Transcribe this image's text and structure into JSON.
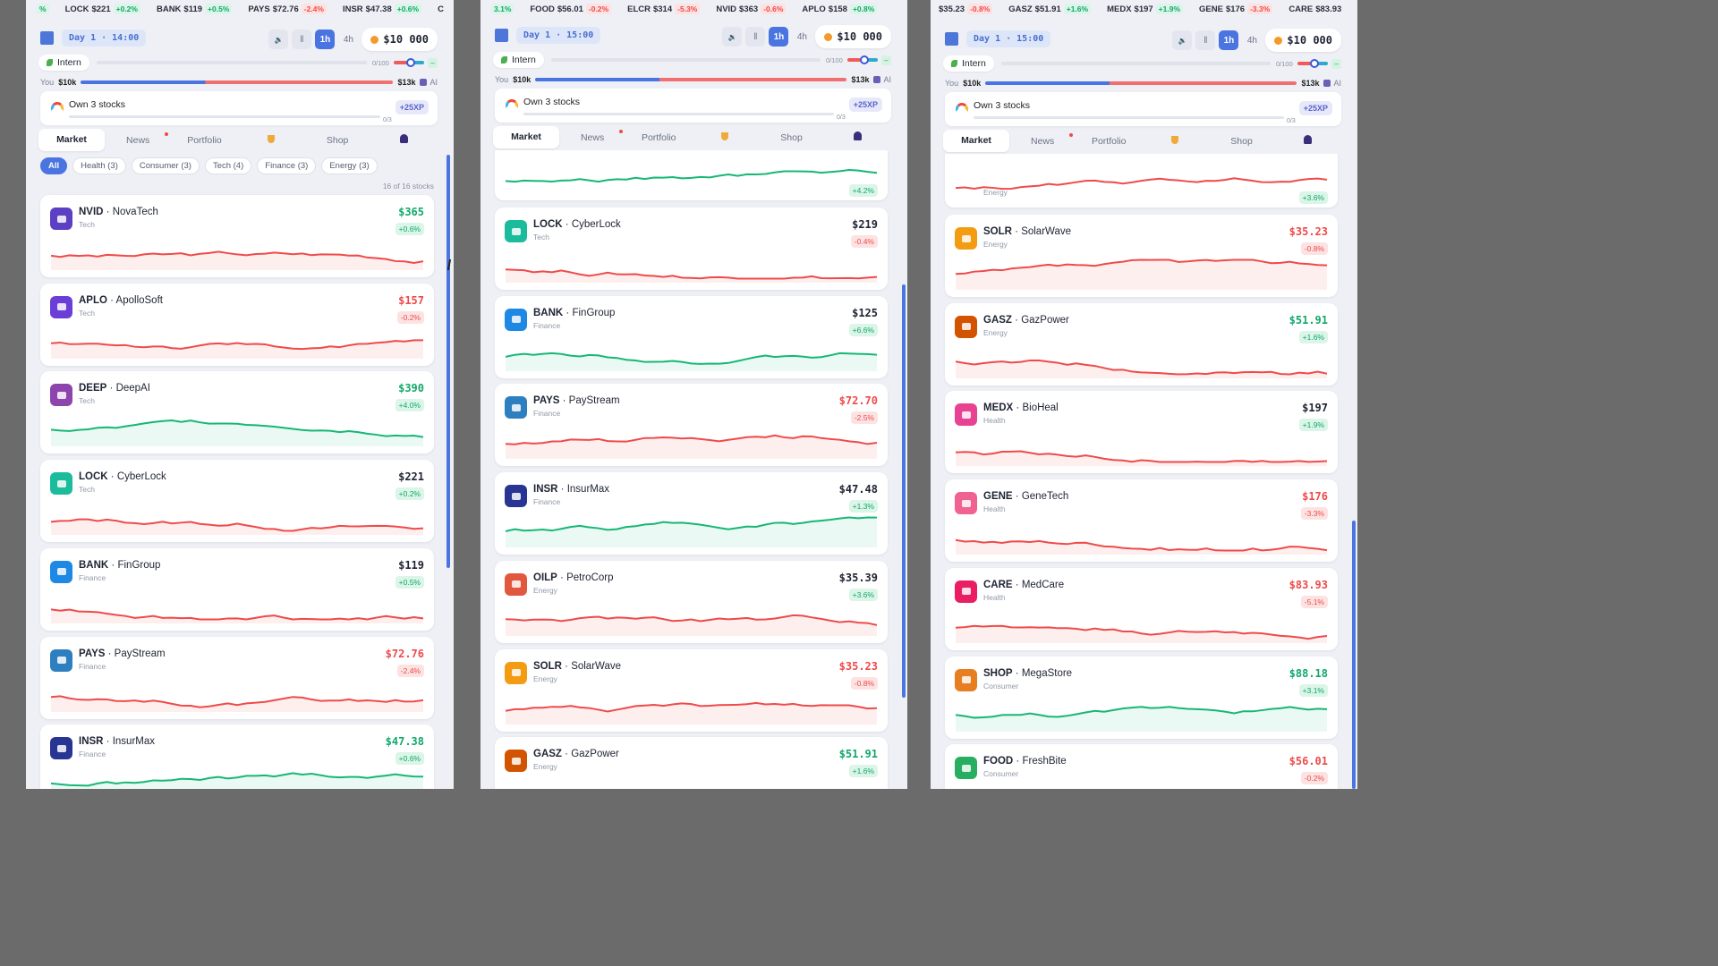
{
  "panels": [
    {
      "ticker": [
        {
          "sym": "",
          "price": "",
          "chg": "%",
          "dir": "up"
        },
        {
          "sym": "LOCK",
          "price": "$221",
          "chg": "+0.2%",
          "dir": "up"
        },
        {
          "sym": "BANK",
          "price": "$119",
          "chg": "+0.5%",
          "dir": "up"
        },
        {
          "sym": "PAYS",
          "price": "$72.76",
          "chg": "-2.4%",
          "dir": "dn"
        },
        {
          "sym": "INSR",
          "price": "$47.38",
          "chg": "+0.6%",
          "dir": "up"
        },
        {
          "sym": "C",
          "price": "",
          "chg": "",
          "dir": "up"
        }
      ],
      "day": "Day 1 · 14:00",
      "cash": "$10 000",
      "rank": "Intern",
      "xp": "0/100",
      "vs": {
        "you": "You",
        "you_val": "$10k",
        "ai_val": "$13k",
        "ai": "AI"
      },
      "goal": {
        "title": "Own 3 stocks",
        "progress": "0/3",
        "reward": "+25XP"
      },
      "tabs": [
        "Market",
        "News",
        "Portfolio",
        "",
        "Shop",
        ""
      ],
      "chips": [
        "All",
        "Health (3)",
        "Consumer (3)",
        "Tech (4)",
        "Finance (3)",
        "Energy (3)"
      ],
      "count": "16 of 16 stocks",
      "stocks": [
        {
          "sym": "NVID",
          "name": "NovaTech",
          "sector": "Tech",
          "price": "$365",
          "chg": "+0.6%",
          "dir": "up",
          "color": "#5b3fc4",
          "trend": "dn"
        },
        {
          "sym": "APLO",
          "name": "ApolloSoft",
          "sector": "Tech",
          "price": "$157",
          "chg": "-0.2%",
          "dir": "dn",
          "color": "#6a3fd8",
          "trend": "dn"
        },
        {
          "sym": "DEEP",
          "name": "DeepAI",
          "sector": "Tech",
          "price": "$390",
          "chg": "+4.0%",
          "dir": "up",
          "color": "#8e44ad",
          "trend": "up"
        },
        {
          "sym": "LOCK",
          "name": "CyberLock",
          "sector": "Tech",
          "price": "$221",
          "chg": "+0.2%",
          "dir": "up",
          "color": "#1abc9c",
          "trend": "dn"
        },
        {
          "sym": "BANK",
          "name": "FinGroup",
          "sector": "Finance",
          "price": "$119",
          "chg": "+0.5%",
          "dir": "up",
          "color": "#1e88e5",
          "trend": "dn"
        },
        {
          "sym": "PAYS",
          "name": "PayStream",
          "sector": "Finance",
          "price": "$72.76",
          "chg": "-2.4%",
          "dir": "dn",
          "color": "#2d7fbf",
          "trend": "dn"
        },
        {
          "sym": "INSR",
          "name": "InsurMax",
          "sector": "Finance",
          "price": "$47.38",
          "chg": "+0.6%",
          "dir": "up",
          "color": "#283593",
          "trend": "up"
        }
      ]
    },
    {
      "ticker": [
        {
          "sym": "",
          "price": "",
          "chg": "3.1%",
          "dir": "up"
        },
        {
          "sym": "FOOD",
          "price": "$56.01",
          "chg": "-0.2%",
          "dir": "dn"
        },
        {
          "sym": "ELCR",
          "price": "$314",
          "chg": "-5.3%",
          "dir": "dn"
        },
        {
          "sym": "NVID",
          "price": "$363",
          "chg": "-0.6%",
          "dir": "dn"
        },
        {
          "sym": "APLO",
          "price": "$158",
          "chg": "+0.8%",
          "dir": "up"
        }
      ],
      "day": "Day 1 · 15:00",
      "cash": "$10 000",
      "rank": "Intern",
      "xp": "0/100",
      "vs": {
        "you": "You",
        "you_val": "$10k",
        "ai_val": "$13k",
        "ai": "AI"
      },
      "goal": {
        "title": "Own 3 stocks",
        "progress": "0/3",
        "reward": "+25XP"
      },
      "tabs": [
        "Market",
        "News",
        "Portfolio",
        "",
        "Shop",
        ""
      ],
      "top_pct": "+4.2%",
      "stocks": [
        {
          "sym": "LOCK",
          "name": "CyberLock",
          "sector": "Tech",
          "price": "$219",
          "chg": "-0.4%",
          "dir": "dn",
          "color": "#1abc9c",
          "trend": "dn"
        },
        {
          "sym": "BANK",
          "name": "FinGroup",
          "sector": "Finance",
          "price": "$125",
          "chg": "+6.6%",
          "dir": "up",
          "color": "#1e88e5",
          "trend": "up"
        },
        {
          "sym": "PAYS",
          "name": "PayStream",
          "sector": "Finance",
          "price": "$72.70",
          "chg": "-2.5%",
          "dir": "dn",
          "color": "#2d7fbf",
          "trend": "dn"
        },
        {
          "sym": "INSR",
          "name": "InsurMax",
          "sector": "Finance",
          "price": "$47.48",
          "chg": "+1.3%",
          "dir": "up",
          "color": "#283593",
          "trend": "up"
        },
        {
          "sym": "OILP",
          "name": "PetroCorp",
          "sector": "Energy",
          "price": "$35.39",
          "chg": "+3.6%",
          "dir": "up",
          "color": "#e2583e",
          "trend": "dn"
        },
        {
          "sym": "SOLR",
          "name": "SolarWave",
          "sector": "Energy",
          "price": "$35.23",
          "chg": "-0.8%",
          "dir": "dn",
          "color": "#f39c12",
          "trend": "dn"
        },
        {
          "sym": "GASZ",
          "name": "GazPower",
          "sector": "Energy",
          "price": "$51.91",
          "chg": "+1.6%",
          "dir": "up",
          "color": "#d35400",
          "trend": "dn"
        }
      ]
    },
    {
      "ticker": [
        {
          "sym": "",
          "price": "$35.23",
          "chg": "-0.8%",
          "dir": "dn"
        },
        {
          "sym": "GASZ",
          "price": "$51.91",
          "chg": "+1.6%",
          "dir": "up"
        },
        {
          "sym": "MEDX",
          "price": "$197",
          "chg": "+1.9%",
          "dir": "up"
        },
        {
          "sym": "GENE",
          "price": "$176",
          "chg": "-3.3%",
          "dir": "dn"
        },
        {
          "sym": "CARE",
          "price": "$83.93",
          "chg": "",
          "dir": "dn"
        }
      ],
      "day": "Day 1 · 15:00",
      "cash": "$10 000",
      "rank": "Intern",
      "xp": "0/100",
      "vs": {
        "you": "You",
        "you_val": "$10k",
        "ai_val": "$13k",
        "ai": "AI"
      },
      "goal": {
        "title": "Own 3 stocks",
        "progress": "0/3",
        "reward": "+25XP"
      },
      "tabs": [
        "Market",
        "News",
        "Portfolio",
        "",
        "Shop",
        ""
      ],
      "top_sector": "Energy",
      "top_pct": "+3.6%",
      "stocks": [
        {
          "sym": "SOLR",
          "name": "SolarWave",
          "sector": "Energy",
          "price": "$35.23",
          "chg": "-0.8%",
          "dir": "dn",
          "color": "#f39c12",
          "trend": "dn"
        },
        {
          "sym": "GASZ",
          "name": "GazPower",
          "sector": "Energy",
          "price": "$51.91",
          "chg": "+1.6%",
          "dir": "up",
          "color": "#d35400",
          "trend": "dn"
        },
        {
          "sym": "MEDX",
          "name": "BioHeal",
          "sector": "Health",
          "price": "$197",
          "chg": "+1.9%",
          "dir": "up",
          "color": "#e84393",
          "trend": "dn"
        },
        {
          "sym": "GENE",
          "name": "GeneTech",
          "sector": "Health",
          "price": "$176",
          "chg": "-3.3%",
          "dir": "dn",
          "color": "#f06292",
          "trend": "dn"
        },
        {
          "sym": "CARE",
          "name": "MedCare",
          "sector": "Health",
          "price": "$83.93",
          "chg": "-5.1%",
          "dir": "dn",
          "color": "#e91e63",
          "trend": "dn"
        },
        {
          "sym": "SHOP",
          "name": "MegaStore",
          "sector": "Consumer",
          "price": "$88.18",
          "chg": "+3.1%",
          "dir": "up",
          "color": "#e67e22",
          "trend": "up"
        },
        {
          "sym": "FOOD",
          "name": "FreshBite",
          "sector": "Consumer",
          "price": "$56.01",
          "chg": "-0.2%",
          "dir": "dn",
          "color": "#27ae60",
          "trend": "dn"
        }
      ]
    }
  ]
}
